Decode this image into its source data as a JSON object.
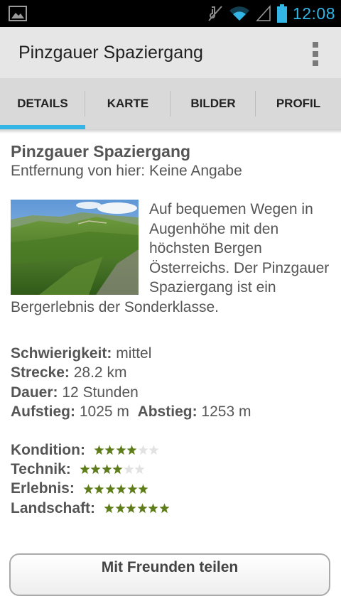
{
  "status_bar": {
    "time": "12:08",
    "icons": [
      "image-icon",
      "mute-icon",
      "wifi-icon",
      "signal-icon",
      "battery-icon"
    ]
  },
  "action_bar": {
    "title": "Pinzgauer Spaziergang",
    "menu_icon": "overflow-menu-icon"
  },
  "tabs": [
    {
      "label": "DETAILS",
      "selected": true
    },
    {
      "label": "KARTE",
      "selected": false
    },
    {
      "label": "BILDER",
      "selected": false
    },
    {
      "label": "PROFIL",
      "selected": false
    }
  ],
  "details": {
    "title": "Pinzgauer Spaziergang",
    "distance": "Entfernung von hier: Keine Angabe",
    "description": "Auf bequemen Wegen in Augenhöhe mit den höchsten Bergen Österreichs. Der Pinzgauer Spaziergang ist ein Bergerlebnis der Sonderklasse.",
    "stats": {
      "difficulty_label": "Schwierigkeit:",
      "difficulty_value": "mittel",
      "route_label": "Strecke:",
      "route_value": "28.2 km",
      "duration_label": "Dauer:",
      "duration_value": "12 Stunden",
      "ascent_label": "Aufstieg:",
      "ascent_value": "1025 m",
      "descent_label": "Abstieg:",
      "descent_value": "1253 m"
    },
    "ratings": [
      {
        "label": "Kondition:",
        "value": 4,
        "max": 6
      },
      {
        "label": "Technik:",
        "value": 4,
        "max": 6
      },
      {
        "label": "Erlebnis:",
        "value": 6,
        "max": 6
      },
      {
        "label": "Landschaft:",
        "value": 6,
        "max": 6
      }
    ],
    "share_label": "Mit Freunden teilen"
  },
  "colors": {
    "accent": "#33b5e5",
    "star_filled": "#5e7d1a",
    "star_empty": "#e2e2e2"
  }
}
